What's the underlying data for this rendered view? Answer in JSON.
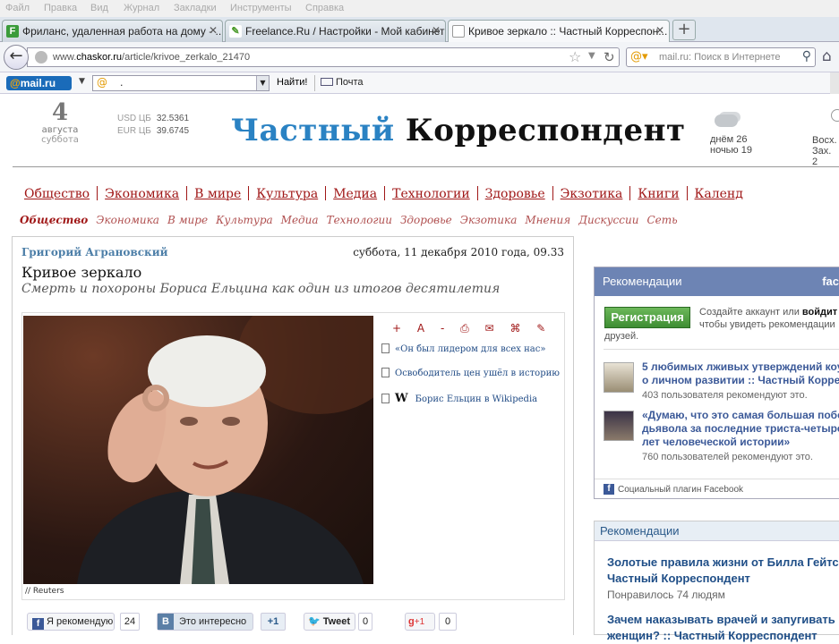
{
  "menu": [
    "Файл",
    "Правка",
    "Вид",
    "Журнал",
    "Закладки",
    "Инструменты",
    "Справка"
  ],
  "tabs": [
    {
      "label": "Фриланс, удаленная работа на дому - ...",
      "icon": "F"
    },
    {
      "label": "Freelance.Ru / Настройки - Мой кабинет",
      "icon": "leaf"
    },
    {
      "label": "Кривое зеркало :: Частный Корреспон...",
      "icon": "page"
    }
  ],
  "address": {
    "prefix": "www.",
    "domain": "chaskor.ru",
    "path": "/article/krivoe_zerkalo_21470"
  },
  "search": {
    "placeholder": "mail.ru: Поиск в Интернете"
  },
  "mailbar": {
    "logo_at": "@",
    "logo_text": "mail.ru",
    "field_value": ".",
    "find_label": "Найти!",
    "mail_label": "Почта"
  },
  "header": {
    "day": "4",
    "month": "августа",
    "weekday": "суббота",
    "usd_label": "USD ЦБ",
    "usd_value": "32.5361",
    "eur_label": "EUR ЦБ",
    "eur_value": "39.6745",
    "logo_blue": "Частный",
    "logo_black": "Корреспондент",
    "weather_day": "днём 26",
    "weather_night": "ночью 19",
    "sunrise": "Восх. ",
    "sunset": "Зах. 2"
  },
  "nav_main": [
    "Общество",
    "Экономика",
    "В мире",
    "Культура",
    "Медиа",
    "Технологии",
    "Здоровье",
    "Экзотика",
    "Книги",
    "Календ"
  ],
  "nav_sub": [
    "Общество",
    "Экономика",
    "В мире",
    "Культура",
    "Медиа",
    "Технологии",
    "Здоровье",
    "Экзотика",
    "Мнения",
    "Дискуссии",
    "Сеть"
  ],
  "article": {
    "author": "Григорий Аграновский",
    "date": "суббота, 11 декабря 2010 года, 09.33",
    "title": "Кривое зеркало",
    "subtitle": "Смерть и похороны Бориса Ельцина как один из итогов десятилетия",
    "photo_credit": "// Reuters",
    "related": [
      "«Он был лидером для всех нас»",
      "Освободитель цен ушёл в историю",
      "Борис Ельцин в Wikipedia"
    ],
    "tools": [
      "+",
      "A",
      "-"
    ]
  },
  "share": {
    "fb_label": "Я рекомендую",
    "fb_count": "24",
    "vk_label": "Это интересно",
    "vk_plus": "+1",
    "tw_label": "Tweet",
    "tw_count": "0",
    "gp_label": "+1",
    "gp_count": "0"
  },
  "fb_widget": {
    "title": "Рекомендации",
    "brand": "fac",
    "register_label": "Регистрация",
    "text_line1": "Создайте аккаунт или ",
    "text_login": "войдит",
    "text_line2": "чтобы увидеть рекомендации",
    "text_line3": "друзей.",
    "items": [
      {
        "title1": "5 любимых лживых утверждений коу",
        "title2": "о личном развитии :: Частный Коррес",
        "count": "403 пользователя рекомендуют это."
      },
      {
        "title1": "«Думаю, что это самая большая побе",
        "title2": "дьявола за последние триста-четыре",
        "title3": "лет человеческой истории»",
        "count": "760 пользователей рекомендуют это."
      }
    ],
    "footer": "Социальный плагин Facebook"
  },
  "rec2": {
    "title": "Рекомендации",
    "items": [
      {
        "line1": "Золотые правила жизни от Билла Гейтса",
        "line2": "Частный Корреспондент",
        "count": "Понравилось 74 людям"
      },
      {
        "line1": "Зачем наказывать врачей и запугивать",
        "line2": "женщин? :: Частный Корреспондент"
      }
    ]
  },
  "colors": {
    "logo_blue": "#2a82c3",
    "nav_red": "#a01818",
    "fb_header": "#6d84b4",
    "register_green": "#4e9e3f"
  }
}
